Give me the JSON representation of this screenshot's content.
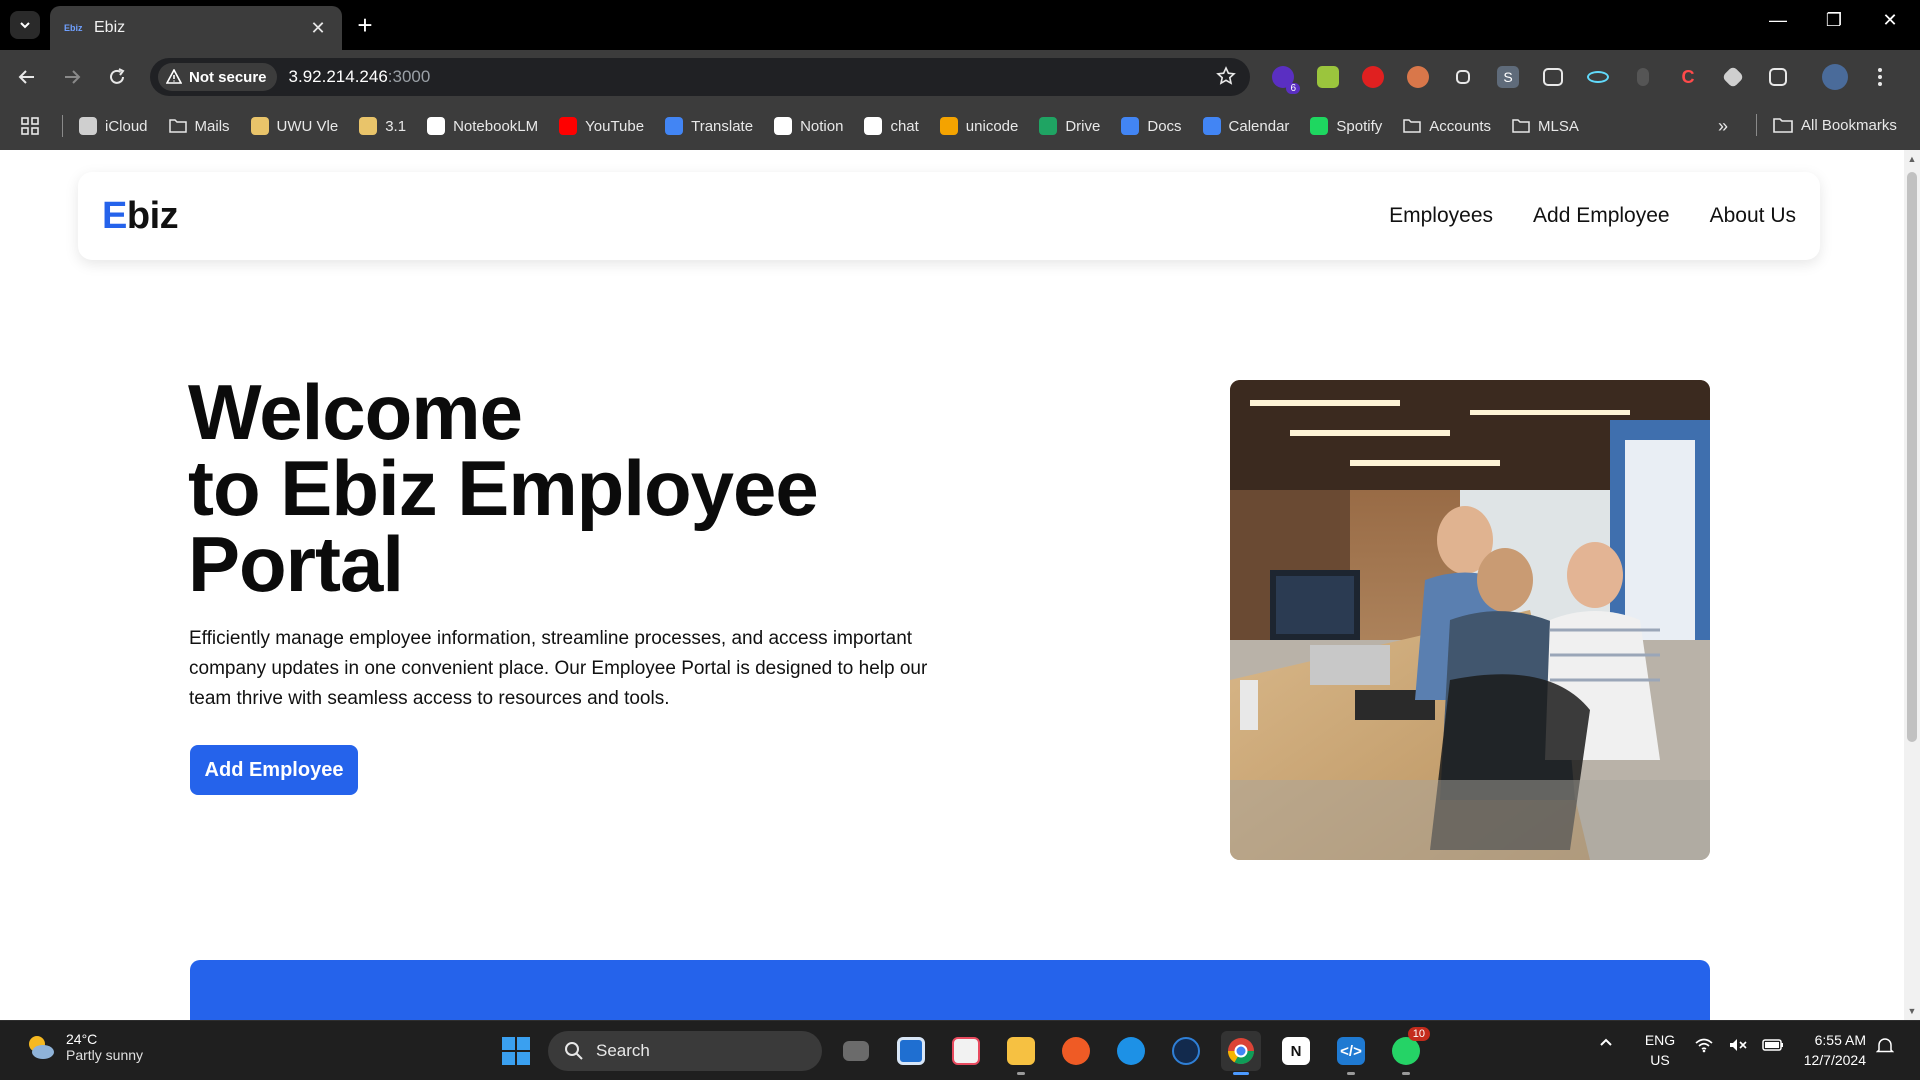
{
  "browser": {
    "tab_title": "Ebiz",
    "tab_favicon_text": "Ebiz",
    "security_label": "Not secure",
    "url_host": "3.92.214.246",
    "url_port": ":3000",
    "extension_badge": "6"
  },
  "bookmarks": [
    {
      "label": "iCloud",
      "icon": "apple-icon",
      "color": "#cfcfcf"
    },
    {
      "label": "Mails",
      "icon": "folder-icon",
      "color": "folder"
    },
    {
      "label": "UWU Vle",
      "icon": "uwu-vle-icon",
      "color": "#e9c46a"
    },
    {
      "label": "3.1",
      "icon": "uwu-vle-icon",
      "color": "#e9c46a"
    },
    {
      "label": "NotebookLM",
      "icon": "notebooklm-icon",
      "color": "#ffffff"
    },
    {
      "label": "YouTube",
      "icon": "youtube-icon",
      "color": "#ff0000"
    },
    {
      "label": "Translate",
      "icon": "translate-icon",
      "color": "#4285f4"
    },
    {
      "label": "Notion",
      "icon": "notion-icon",
      "color": "#ffffff"
    },
    {
      "label": "chat",
      "icon": "chatgpt-icon",
      "color": "#ffffff"
    },
    {
      "label": "unicode",
      "icon": "unicode-icon",
      "color": "#f4a300"
    },
    {
      "label": "Drive",
      "icon": "drive-icon",
      "color": "#1fa463"
    },
    {
      "label": "Docs",
      "icon": "docs-icon",
      "color": "#4285f4"
    },
    {
      "label": "Calendar",
      "icon": "calendar-icon",
      "color": "#4285f4"
    },
    {
      "label": "Spotify",
      "icon": "spotify-icon",
      "color": "#1ed760"
    },
    {
      "label": "Accounts",
      "icon": "folder-icon",
      "color": "folder"
    },
    {
      "label": "MLSA",
      "icon": "folder-icon",
      "color": "folder"
    }
  ],
  "all_bookmarks_label": "All Bookmarks",
  "site": {
    "logo_first": "E",
    "logo_rest": "biz",
    "nav": [
      "Employees",
      "Add Employee",
      "About Us"
    ],
    "hero_line1": "Welcome",
    "hero_line2": "to Ebiz Employee",
    "hero_line3": "Portal",
    "hero_text": "Efficiently manage employee information, streamline processes, and access important company updates in one convenient place. Our Employee Portal is designed to help our team thrive with seamless access to resources and tools.",
    "cta_label": "Add Employee",
    "accent_color": "#2563eb"
  },
  "taskbar": {
    "temperature": "24°C",
    "weather": "Partly sunny",
    "search_placeholder": "Search",
    "whatsapp_count": "10",
    "lang_top": "ENG",
    "lang_bottom": "US",
    "time": "6:55 AM",
    "date": "12/7/2024"
  }
}
